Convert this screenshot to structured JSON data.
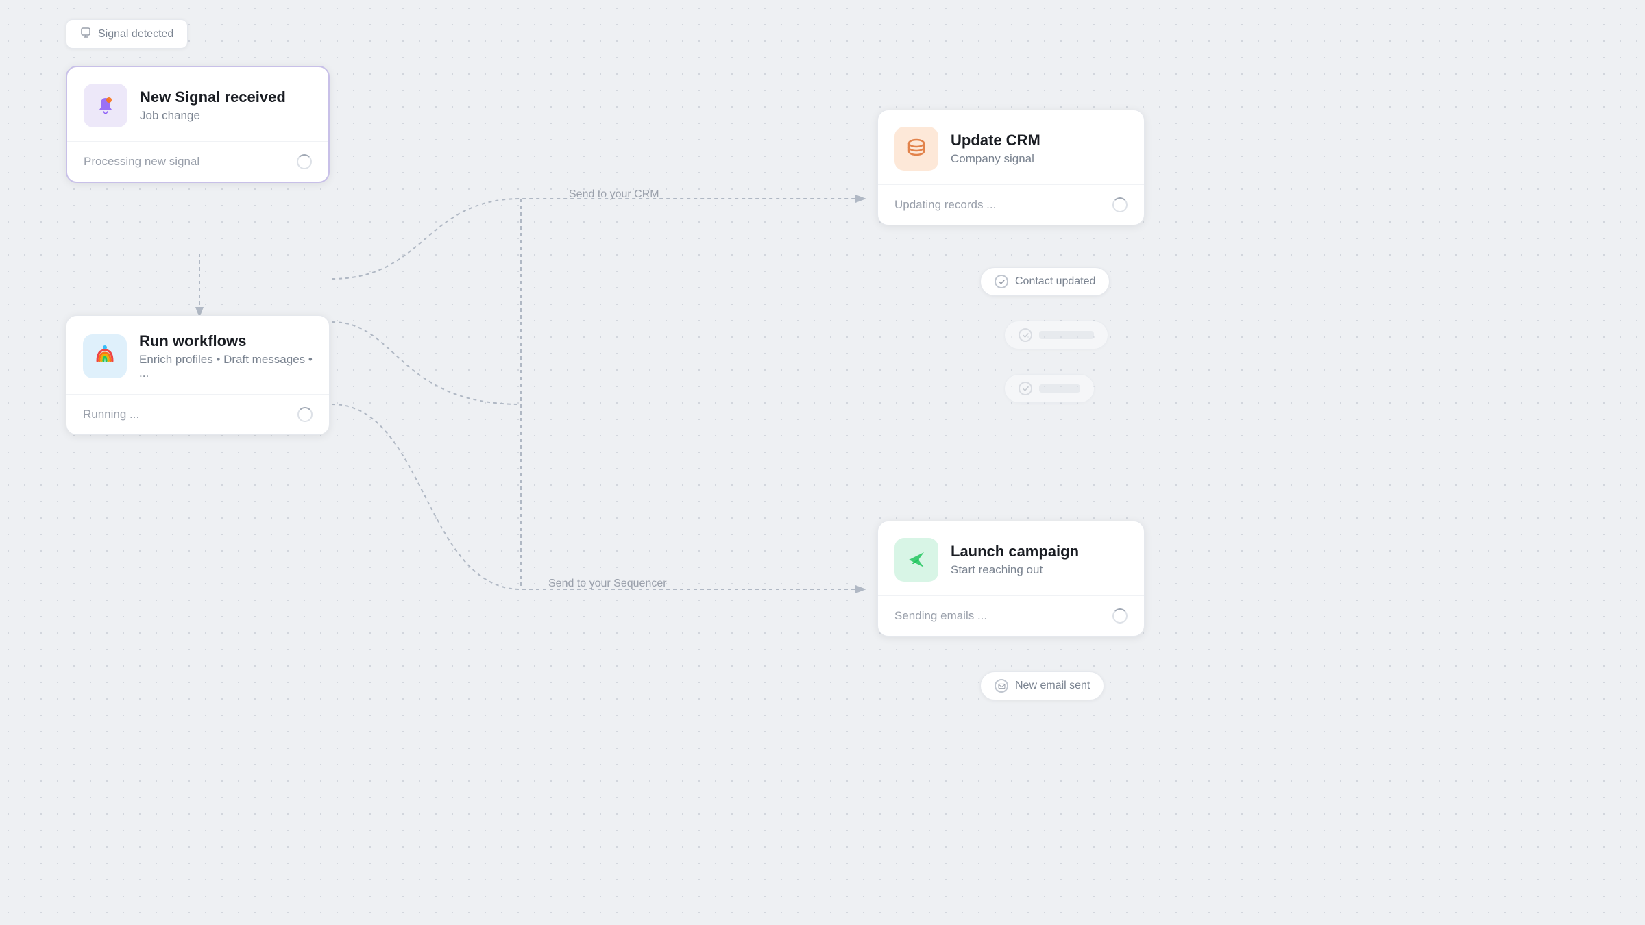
{
  "signal_detected_pill": {
    "label": "Signal detected",
    "icon": "signal-icon"
  },
  "new_signal_card": {
    "title": "New Signal received",
    "subtitle": "Job change",
    "footer_text": "Processing new signal",
    "icon": "bell-icon",
    "icon_bg": "purple"
  },
  "run_workflows_card": {
    "title": "Run workflows",
    "subtitle": "Enrich profiles • Draft messages • ...",
    "footer_text": "Running ...",
    "icon": "workflow-icon",
    "icon_bg": "blue"
  },
  "update_crm_card": {
    "title": "Update CRM",
    "subtitle": "Company signal",
    "footer_text": "Updating records ...",
    "icon": "database-icon",
    "icon_bg": "orange"
  },
  "launch_campaign_card": {
    "title": "Launch campaign",
    "subtitle": "Start reaching out",
    "footer_text": "Sending emails ...",
    "icon": "send-icon",
    "icon_bg": "green"
  },
  "connections": {
    "send_to_crm": "Send to your CRM",
    "send_to_sequencer": "Send to your Sequencer"
  },
  "status_badges": {
    "contact_updated": "Contact updated",
    "badge2": "...",
    "badge3": "...",
    "new_email_sent": "New email sent"
  }
}
